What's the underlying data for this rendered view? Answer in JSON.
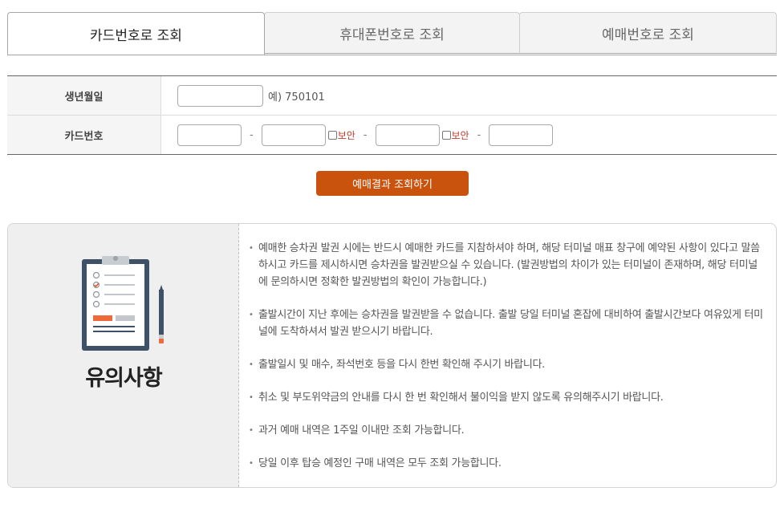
{
  "tabs": [
    {
      "label": "카드번호로 조회",
      "active": true
    },
    {
      "label": "휴대폰번호로 조회",
      "active": false
    },
    {
      "label": "예매번호로 조회",
      "active": false
    }
  ],
  "form": {
    "birth_label": "생년월일",
    "birth_value": "",
    "birth_example": "예) 750101",
    "card_label": "카드번호",
    "card_dash": "-",
    "secure_label": "보안"
  },
  "search_button": "예매결과 조회하기",
  "notice": {
    "title": "유의사항",
    "items": [
      "예매한 승차권 발권 시에는 반드시 예매한 카드를 지참하셔야 하며, 해당 터미널 매표 창구에 예약된 사항이 있다고 말씀하시고 카드를 제시하시면 승차권을 발권받으실 수 있습니다. (발권방법의 차이가 있는 터미널이 존재하며, 해당 터미널에 문의하시면 정확한 발권방법의 확인이 가능합니다.)",
      "출발시간이 지난 후에는 승차권을 발권받을 수 없습니다. 출발 당일 터미널 혼잡에 대비하여 출발시간보다 여유있게 터미널에 도착하셔서 발권 받으시기 바랍니다.",
      "출발일시 및 매수, 좌석번호 등을 다시 한번 확인해 주시기 바랍니다.",
      "취소 및 부도위약금의 안내를 다시 한 번 확인해서 불이익을 받지 않도록 유의해주시기 바랍니다.",
      "과거 예매 내역은 1주일 이내만 조회 가능합니다.",
      "당일 이후 탑승 예정인 구매 내역은 모두 조회 가능합니다."
    ]
  },
  "colors": {
    "accent": "#c9530d",
    "secure": "#c0392b"
  },
  "icons": {
    "notice": "clipboard-checklist-icon",
    "pencil": "pencil-icon"
  }
}
